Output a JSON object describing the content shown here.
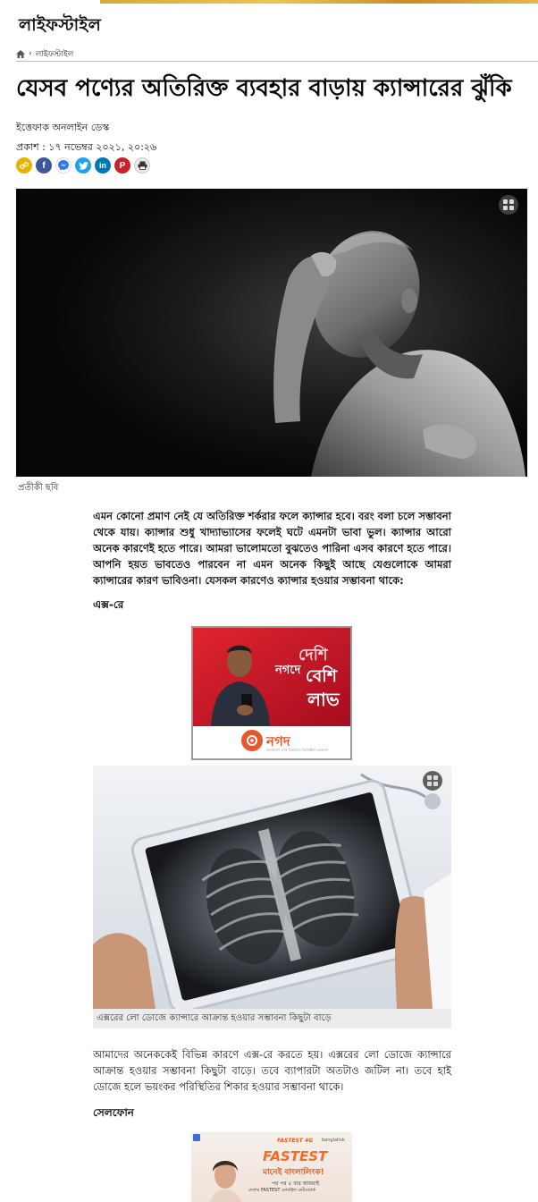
{
  "section": {
    "title": "লাইফস্টাইল"
  },
  "breadcrumb": {
    "separator": "›",
    "current": "লাইফস্টাইল"
  },
  "article": {
    "headline": "যেসব পণ্যের অতিরিক্ত ব্যবহার বাড়ায় ক্যান্সারের ঝুঁকি",
    "author": "ইত্তেফাক অনলাইন ডেস্ক",
    "published": "প্রকাশ : ১৭ নভেম্বর ২০২১, ২০:২৬",
    "hero_caption": "প্রতীকী ছবি",
    "intro": "এমন কোনো প্রমাণ নেই যে অতিরিক্ত শর্করার ফলে ক্যান্সার হবে। বরং বলা চলে সম্ভাবনা থেকে যায়। ক্যান্সার শুধু খাদ্যাভ্যাসের ফলেই ঘটে এমনটা ভাবা ভুল। ক্যান্সার আরো অনেক কারণেই হতে পারে। আমরা ভালোমতো বুঝতেও পারিনা এসব কারণে হতে পারে। আপনি হয়ত ভাবতেও পারবেন না এমন অনেক কিছুই আছে যেগুলোকে আমরা ক্যান্সারের কারণ ভাবিওনা। যেসকল কারণেও ক্যান্সার হওয়ার সম্ভাবনা থাকে:",
    "heading_xray": "এক্স-রে",
    "xray_caption": "এক্সরের লো ডোজে ক্যান্সারে আক্রান্ত হওয়ার সম্ভাবনা কিছুটা বাড়ে",
    "xray_text": "আমাদের অনেককেই বিভিন্ন কারণে এক্স-রে করতে হয়। এক্সরের লো ডোজে ক্যান্সারে আক্রান্ত হওয়ার সম্ভাবনা কিছুটা বাড়ে। তবে ব্যাপারটা অতটাও জটিল না। তবে হাই ডোজে হলে ভয়ংকর পরিস্থিতির শিকার হওয়ার সম্ভাবনা থাকে।",
    "heading_phone": "সেলফোন"
  },
  "ads": {
    "nagad": {
      "line1": "দেশি",
      "line2": "নগদে",
      "line3": "বেশি",
      "line4": "লাভ",
      "brand": "নগদ",
      "tagline": "বাংলাদেশ ডাক বিভাগের ডিজিটাল লেনদেন"
    },
    "banglalink": {
      "top": "FASTEST 4G",
      "brand": "banglalink",
      "headline": "FASTEST",
      "sub": "মানেই বাংলালিংক!",
      "line": "পর পর ৫ বার আমরাই",
      "line2": "দেশের FASTEST মোবাইল নেটওয়ার্ক"
    }
  },
  "colors": {
    "nagad_red": "#c8102e",
    "facebook": "#3b5998",
    "messenger": "#2b7bf5",
    "twitter": "#1da1f2",
    "linkedin": "#0077b5",
    "pinterest": "#cb2027",
    "copy": "#e7b400"
  },
  "icons": [
    "home-icon",
    "copy-link-icon",
    "facebook-icon",
    "messenger-icon",
    "twitter-icon",
    "linkedin-icon",
    "pinterest-icon",
    "print-icon",
    "gallery-icon"
  ]
}
